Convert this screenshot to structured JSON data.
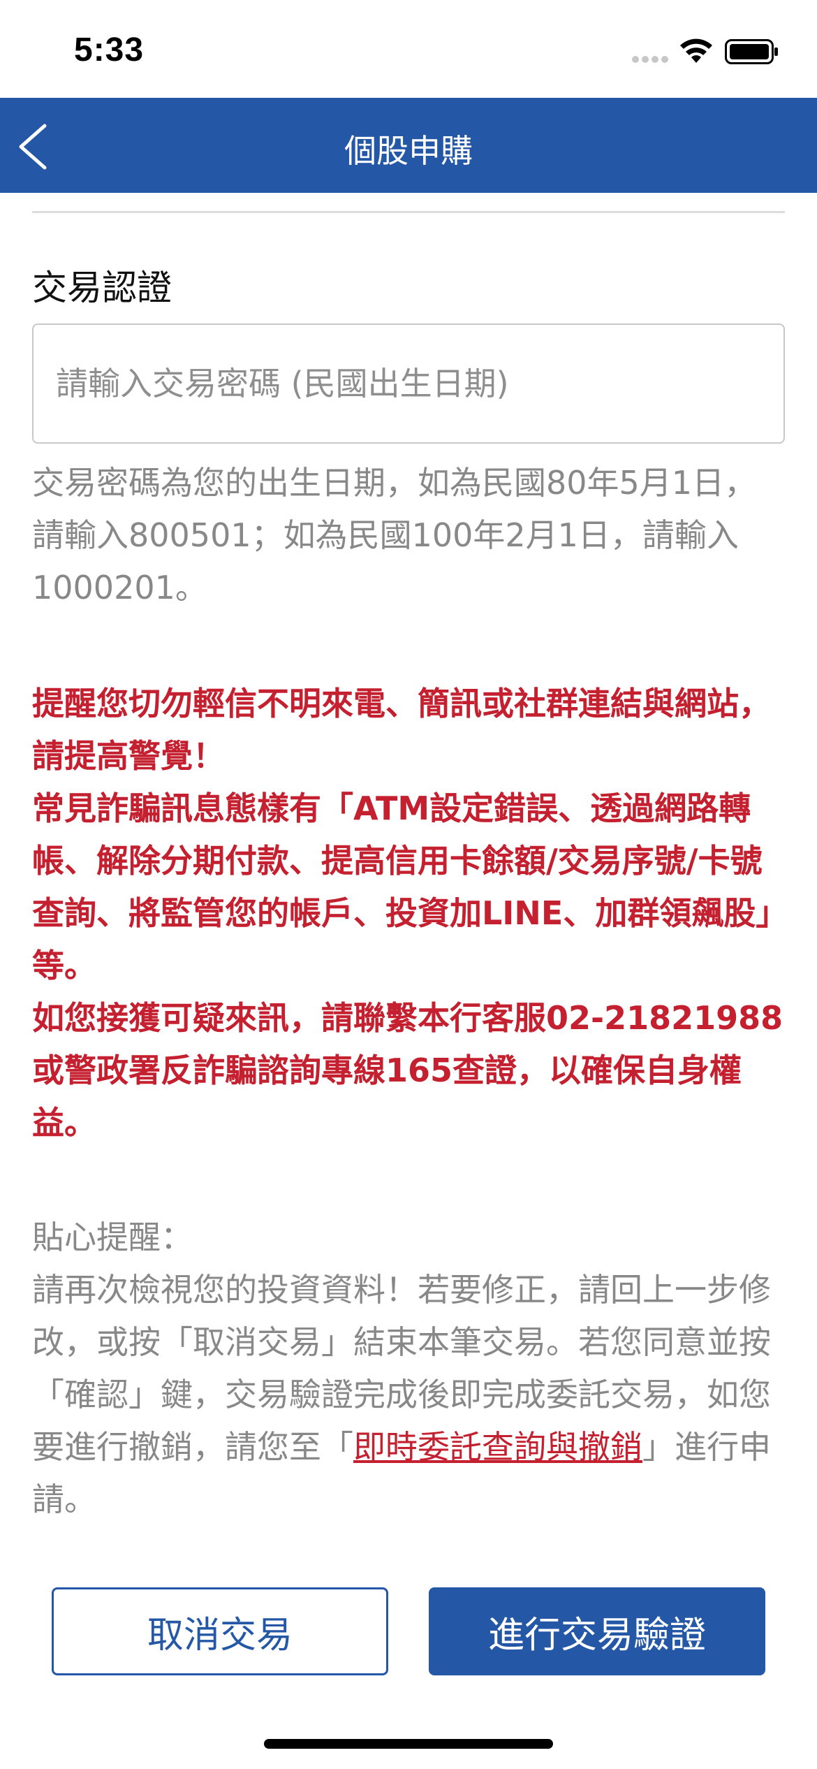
{
  "status_bar": {
    "time": "5:33"
  },
  "nav": {
    "title": "個股申購",
    "back_icon": "chevron-left-icon"
  },
  "auth": {
    "section_title": "交易認證",
    "password_placeholder": "請輸入交易密碼 (民國出生日期)",
    "password_value": "",
    "hint": "交易密碼為您的出生日期，如為民國80年5月1日，請輸入800501；如為民國100年2月1日，請輸入1000201。"
  },
  "warning": {
    "line1": "提醒您切勿輕信不明來電、簡訊或社群連結與網站，請提高警覺！",
    "line2": "常見詐騙訊息態樣有「ATM設定錯誤、透過網路轉帳、解除分期付款、提高信用卡餘額/交易序號/卡號查詢、將監管您的帳戶、投資加LINE、加群領飆股」等。",
    "line3": "如您接獲可疑來訊，請聯繫本行客服02-21821988或警政署反詐騙諮詢專線165查證，以確保自身權益。"
  },
  "reminder": {
    "title": "貼心提醒：",
    "body_before_link": "請再次檢視您的投資資料！若要修正，請回上一步修改，或按「取消交易」結束本筆交易。若您同意並按「確認」鍵，交易驗證完成後即完成委託交易，如您要進行撤銷，請您至「",
    "link_text": "即時委託查詢與撤銷",
    "body_after_link": "」進行申請。"
  },
  "buttons": {
    "cancel_label": "取消交易",
    "confirm_label": "進行交易驗證"
  },
  "colors": {
    "primary": "#2458a6",
    "warning": "#c4202f",
    "muted_text": "#888888"
  }
}
